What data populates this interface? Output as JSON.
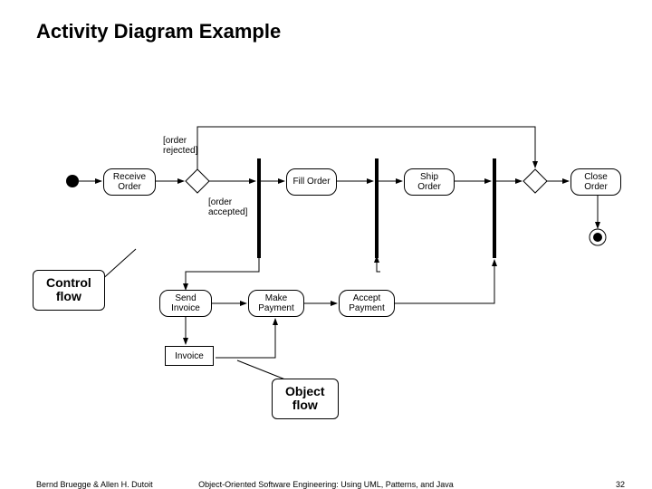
{
  "title": "Activity Diagram Example",
  "guards": {
    "rejected": "[order\nrejected]",
    "accepted": "[order\naccepted]"
  },
  "activities": {
    "receive": "Receive\nOrder",
    "fill": "Fill\nOrder",
    "ship": "Ship\nOrder",
    "close": "Close\nOrder",
    "sendInvoice": "Send\nInvoice",
    "makePayment": "Make\nPayment",
    "acceptPayment": "Accept\nPayment"
  },
  "objects": {
    "invoice": "Invoice"
  },
  "callouts": {
    "control": "Control\nflow",
    "object": "Object\nflow"
  },
  "footer": {
    "authors": "Bernd Bruegge & Allen H. Dutoit",
    "book": "Object-Oriented Software Engineering: Using UML, Patterns, and Java",
    "page": "32"
  }
}
